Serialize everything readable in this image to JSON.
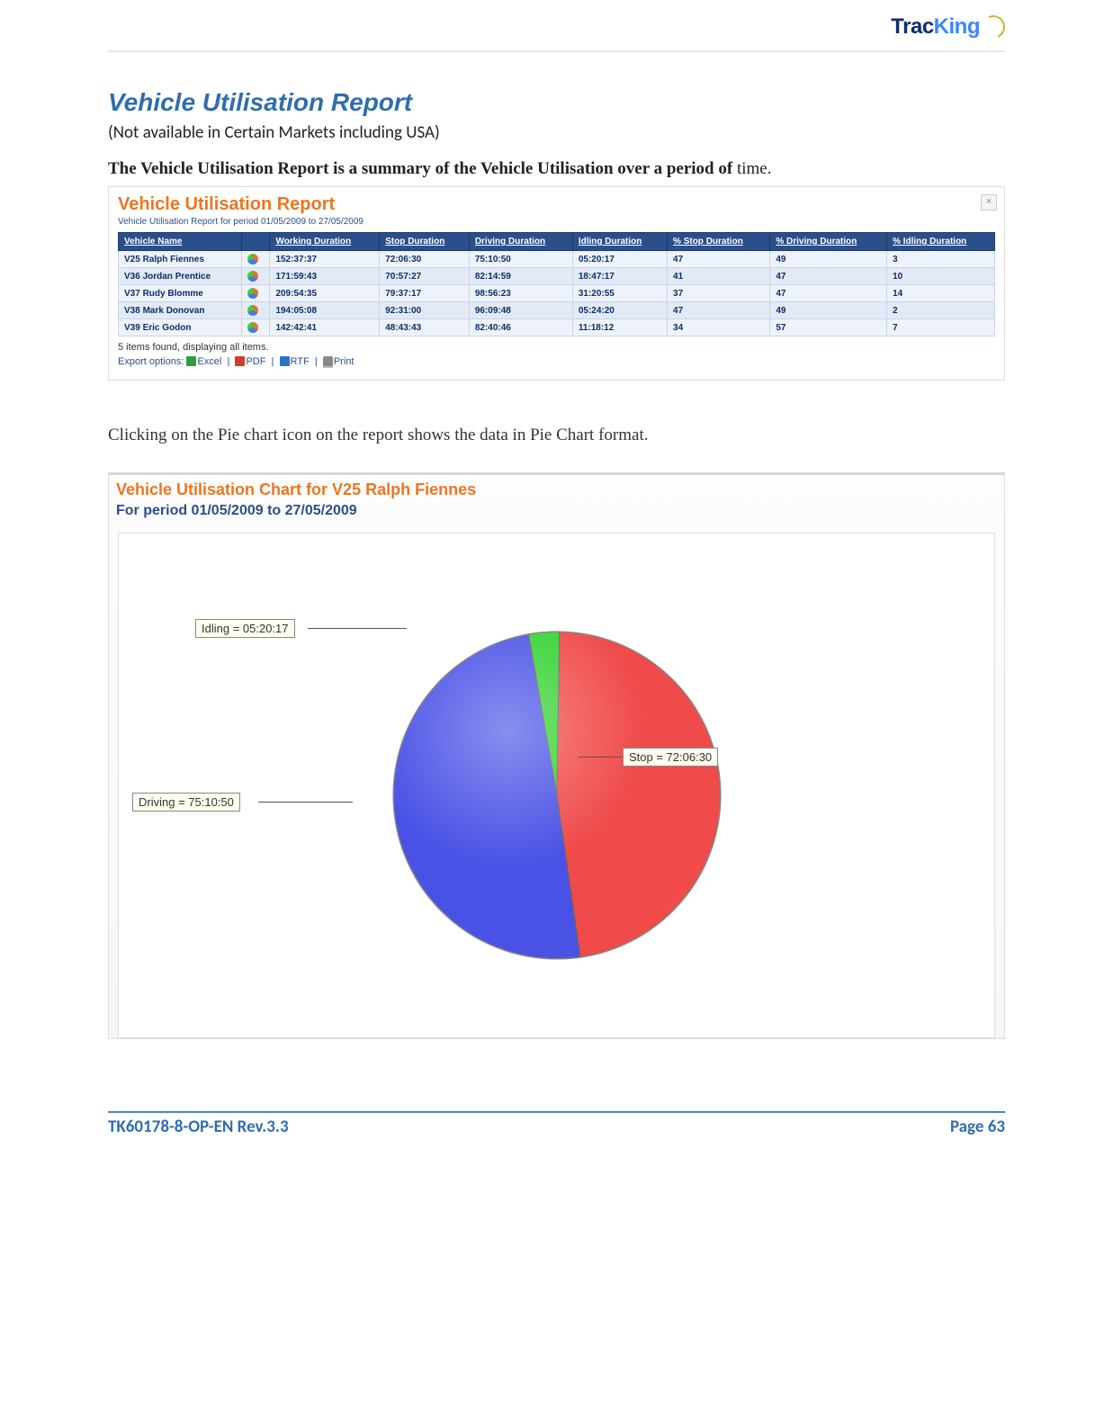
{
  "logo": {
    "part1": "Trac",
    "part2": "King"
  },
  "title": "Vehicle Utilisation Report",
  "subtitle": "(Not available in Certain Markets including USA)",
  "lead_bold": "The Vehicle Utilisation Report is a summary of the Vehicle Utilisation over a period of ",
  "lead_tail": "time.",
  "shot1": {
    "heading": "Vehicle Utilisation Report",
    "subheading": "Vehicle Utilisation Report for period 01/05/2009 to 27/05/2009",
    "columns": [
      "Vehicle Name",
      "",
      "Working Duration",
      "Stop Duration",
      "Driving Duration",
      "Idling Duration",
      "% Stop Duration",
      "% Driving Duration",
      "% Idling Duration"
    ],
    "rows": [
      [
        "V25 Ralph Fiennes",
        "pie",
        "152:37:37",
        "72:06:30",
        "75:10:50",
        "05:20:17",
        "47",
        "49",
        "3"
      ],
      [
        "V36 Jordan Prentice",
        "pie",
        "171:59:43",
        "70:57:27",
        "82:14:59",
        "18:47:17",
        "41",
        "47",
        "10"
      ],
      [
        "V37 Rudy Blomme",
        "pie",
        "209:54:35",
        "79:37:17",
        "98:56:23",
        "31:20:55",
        "37",
        "47",
        "14"
      ],
      [
        "V38 Mark Donovan",
        "pie",
        "194:05:08",
        "92:31:00",
        "96:09:48",
        "05:24:20",
        "47",
        "49",
        "2"
      ],
      [
        "V39 Eric Godon",
        "pie",
        "142:42:41",
        "48:43:43",
        "82:40:46",
        "11:18:12",
        "34",
        "57",
        "7"
      ]
    ],
    "footer_count": "5 items found, displaying all items.",
    "export_prefix": "Export options: ",
    "export_excel": "Excel",
    "export_pdf": "PDF",
    "export_rtf": "RTF",
    "export_print": "Print",
    "close_glyph": "×"
  },
  "midtext": "Clicking on the Pie chart icon on the report shows the data in Pie Chart format.",
  "shot2": {
    "title": "Vehicle Utilisation Chart for V25 Ralph Fiennes",
    "period": "For period 01/05/2009 to 27/05/2009",
    "ann_idling": "Idling = 05:20:17",
    "ann_stop": "Stop = 72:06:30",
    "ann_driving": "Driving = 75:10:50"
  },
  "chart_data": {
    "type": "pie",
    "title": "Vehicle Utilisation Chart for V25 Ralph Fiennes",
    "subtitle": "For period 01/05/2009 to 27/05/2009",
    "series": [
      {
        "name": "Idling",
        "value": "05:20:17",
        "percent": 3,
        "color": "#34d232"
      },
      {
        "name": "Stop",
        "value": "72:06:30",
        "percent": 47,
        "color": "#f04a4a"
      },
      {
        "name": "Driving",
        "value": "75:10:50",
        "percent": 49,
        "color": "#4a52e6"
      }
    ]
  },
  "footer": {
    "left": "TK60178-8-OP-EN Rev.3.3",
    "right_label": "Page  ",
    "right_num": "63"
  }
}
